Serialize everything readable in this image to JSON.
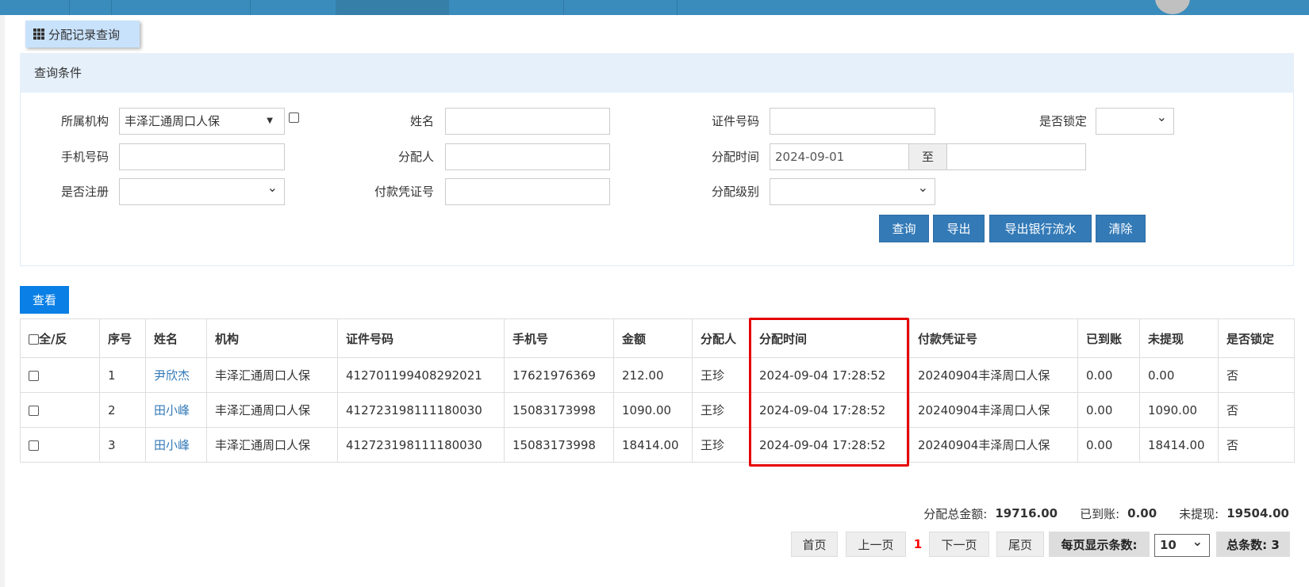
{
  "tab": {
    "label": "分配记录查询"
  },
  "query": {
    "title": "查询条件",
    "org_label": "所属机构",
    "org_value": "丰泽汇通周口人保",
    "name_label": "姓名",
    "id_label": "证件号码",
    "locked_label": "是否锁定",
    "phone_label": "手机号码",
    "assigner_label": "分配人",
    "time_label": "分配时间",
    "time_from": "2024-09-01",
    "time_to_sep": "至",
    "registered_label": "是否注册",
    "voucher_label": "付款凭证号",
    "level_label": "分配级别",
    "btn_query": "查询",
    "btn_export": "导出",
    "btn_export_bank": "导出银行流水",
    "btn_clear": "清除"
  },
  "view_button": "查看",
  "table": {
    "headers": [
      "全/反",
      "序号",
      "姓名",
      "机构",
      "证件号码",
      "手机号",
      "金额",
      "分配人",
      "分配时间",
      "付款凭证号",
      "已到账",
      "未提现",
      "是否锁定"
    ],
    "rows": [
      [
        "1",
        "尹欣杰",
        "丰泽汇通周口人保",
        "412701199408292021",
        "17621976369",
        "212.00",
        "王珍",
        "2024-09-04 17:28:52",
        "20240904丰泽周口人保",
        "0.00",
        "0.00",
        "否"
      ],
      [
        "2",
        "田小峰",
        "丰泽汇通周口人保",
        "412723198111180030",
        "15083173998",
        "1090.00",
        "王珍",
        "2024-09-04 17:28:52",
        "20240904丰泽周口人保",
        "0.00",
        "1090.00",
        "否"
      ],
      [
        "3",
        "田小峰",
        "丰泽汇通周口人保",
        "412723198111180030",
        "15083173998",
        "18414.00",
        "王珍",
        "2024-09-04 17:28:52",
        "20240904丰泽周口人保",
        "0.00",
        "18414.00",
        "否"
      ]
    ]
  },
  "summary": {
    "total_label": "分配总金额:",
    "total": "19716.00",
    "arrived_label": "已到账:",
    "arrived": "0.00",
    "unwithdrawn_label": "未提现:",
    "unwithdrawn": "19504.00"
  },
  "pagination": {
    "first": "首页",
    "prev": "上一页",
    "current": "1",
    "next": "下一页",
    "last": "尾页",
    "per_page_label": "每页显示条数:",
    "per_page": "10",
    "total_label": "总条数: 3"
  }
}
